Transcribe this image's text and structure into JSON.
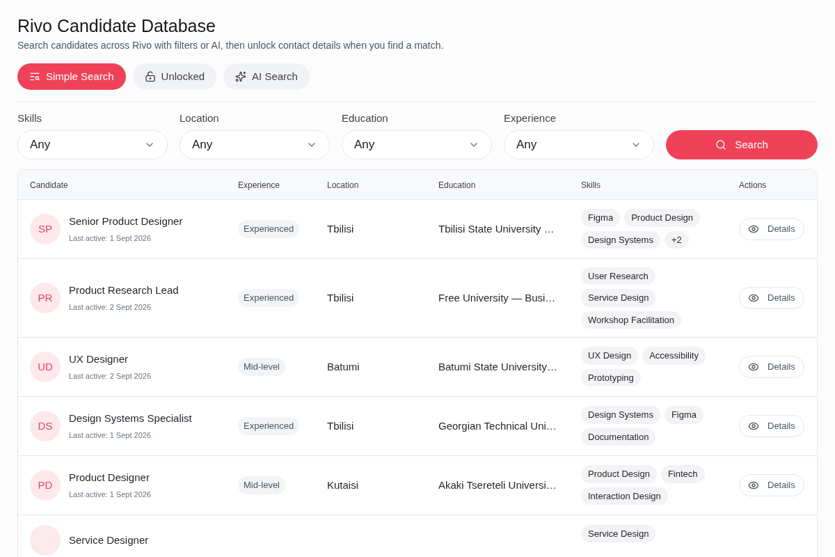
{
  "header": {
    "title": "Rivo Candidate Database",
    "subtitle": "Search candidates across Rivo with filters or AI, then unlock contact details when you find a match."
  },
  "tabs": [
    {
      "label": "Simple Search",
      "kind": "list-search",
      "selected": true
    },
    {
      "label": "Unlocked",
      "kind": "lock",
      "selected": false
    },
    {
      "label": "AI Search",
      "kind": "sparkle",
      "selected": false
    }
  ],
  "filters": [
    {
      "label": "Skills",
      "value": "Any"
    },
    {
      "label": "Location",
      "value": "Any"
    },
    {
      "label": "Education",
      "value": "Any"
    },
    {
      "label": "Experience",
      "value": "Any"
    }
  ],
  "search_button": "Search",
  "table": {
    "columns": [
      "Candidate",
      "Experience",
      "Location",
      "Education",
      "Skills",
      "Actions"
    ],
    "rows": [
      {
        "initials": "SP",
        "name": "Senior Product Designer",
        "last_active": "Last active: 1 Sept 2026",
        "experience": "Experienced",
        "location": "Tbilisi",
        "education": "Tbilisi State University …",
        "skills": [
          "Figma",
          "Product Design",
          "Design Systems",
          "+2"
        ],
        "action": "Details"
      },
      {
        "initials": "PR",
        "name": "Product Research Lead",
        "last_active": "Last active: 2 Sept 2026",
        "experience": "Experienced",
        "location": "Tbilisi",
        "education": "Free University — Busi…",
        "skills": [
          "User Research",
          "Service Design",
          "Workshop Facilitation"
        ],
        "action": "Details"
      },
      {
        "initials": "UD",
        "name": "UX Designer",
        "last_active": "Last active: 2 Sept 2026",
        "experience": "Mid-level",
        "location": "Batumi",
        "education": "Batumi State University…",
        "skills": [
          "UX Design",
          "Accessibility",
          "Prototyping"
        ],
        "action": "Details"
      },
      {
        "initials": "DS",
        "name": "Design Systems Specialist",
        "last_active": "Last active: 1 Sept 2026",
        "experience": "Experienced",
        "location": "Tbilisi",
        "education": "Georgian Technical Uni…",
        "skills": [
          "Design Systems",
          "Figma",
          "Documentation"
        ],
        "action": "Details"
      },
      {
        "initials": "PD",
        "name": "Product Designer",
        "last_active": "Last active: 1 Sept 2026",
        "experience": "Mid-level",
        "location": "Kutaisi",
        "education": "Akaki Tsereteli Universi…",
        "skills": [
          "Product Design",
          "Fintech",
          "Interaction Design"
        ],
        "action": "Details"
      },
      {
        "name": "Service Designer",
        "skills": [
          "Service Design"
        ]
      }
    ]
  }
}
